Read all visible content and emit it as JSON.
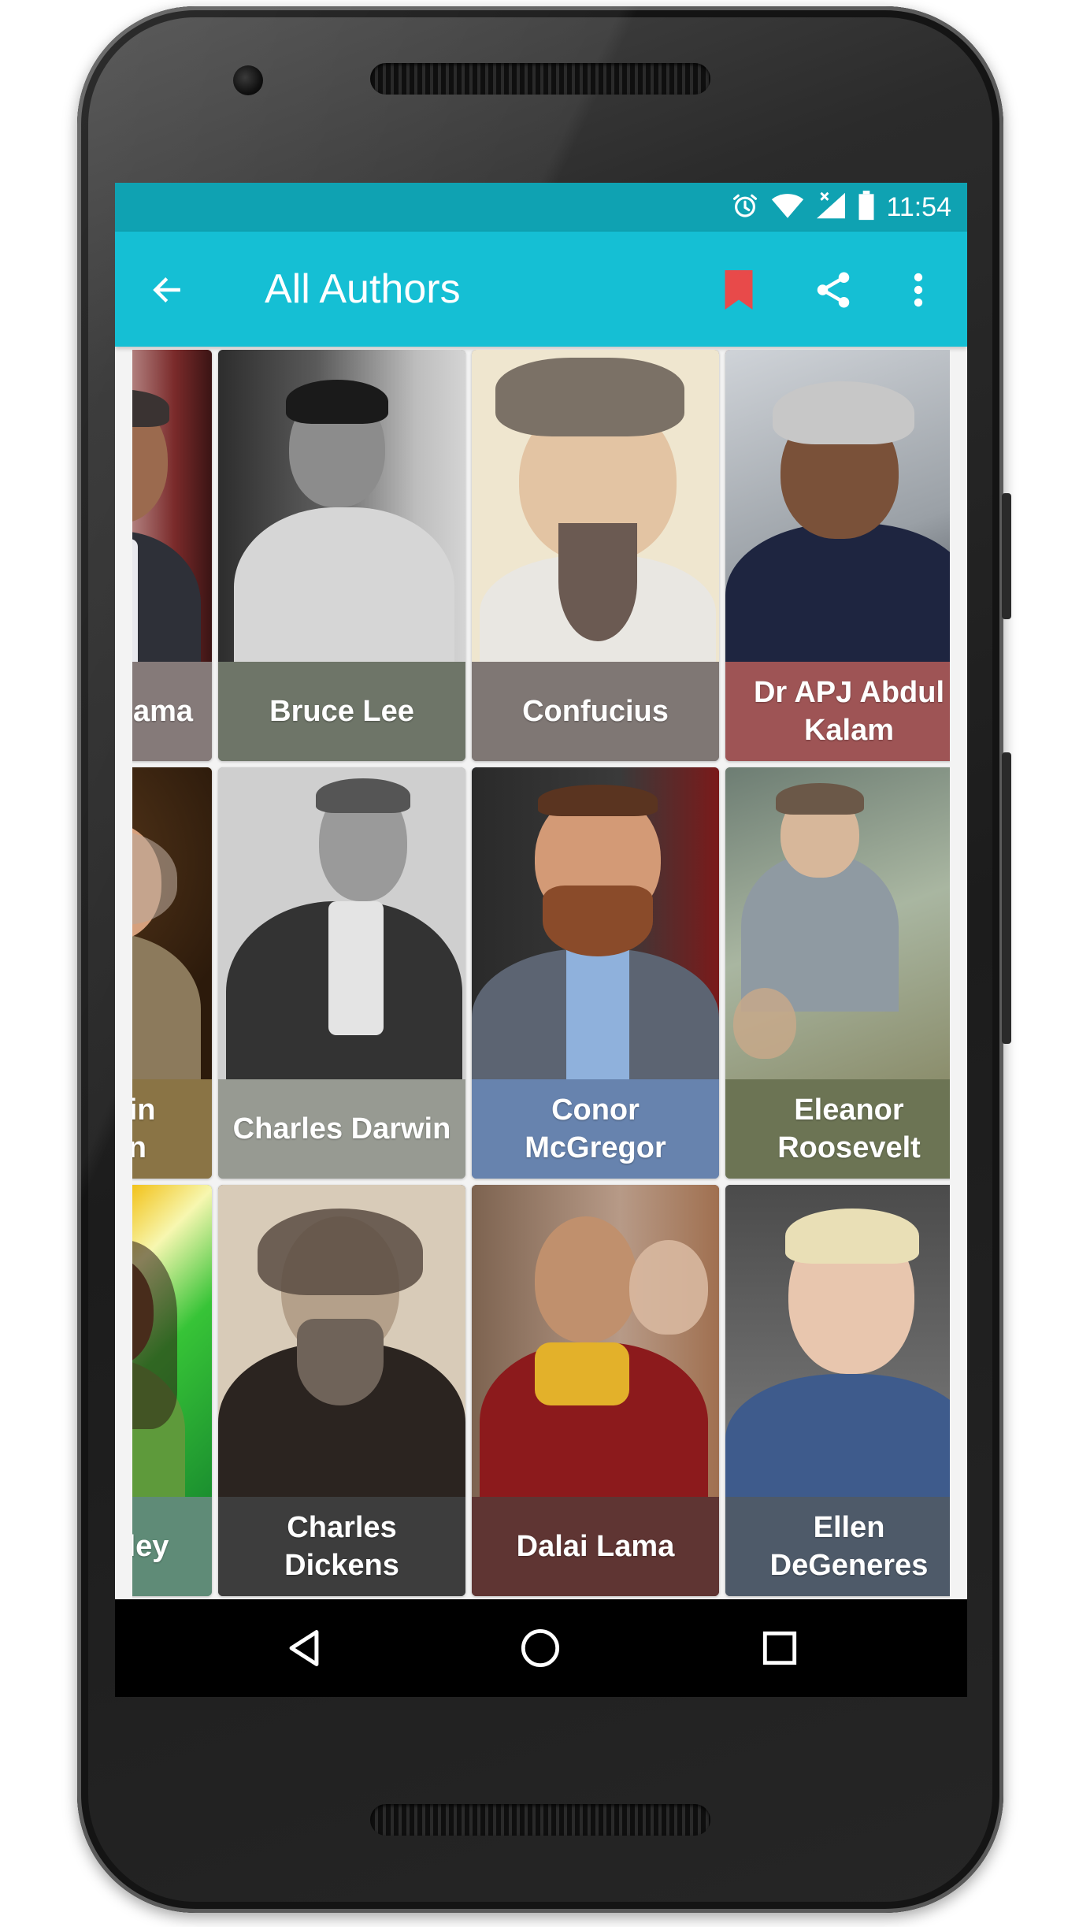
{
  "status_bar": {
    "time": "11:54",
    "icons": [
      "alarm-icon",
      "wifi-icon",
      "signal-icon",
      "battery-icon"
    ]
  },
  "app_bar": {
    "title": "All Authors",
    "actions": [
      "back-arrow-icon",
      "bookmark-icon",
      "share-icon",
      "more-vert-icon"
    ]
  },
  "colors": {
    "status_bar": "#0fa2b2",
    "app_bar": "#15bfd4",
    "bookmark": "#e84a4a"
  },
  "authors": [
    {
      "name": "Barack Obama",
      "caption_color": "#857a79"
    },
    {
      "name": "Bruce Lee",
      "caption_color": "#6e7568"
    },
    {
      "name": "Confucius",
      "caption_color": "#7f7774"
    },
    {
      "name": "Dr APJ Abdul Kalam",
      "caption_color": "#9e5455"
    },
    {
      "name": "Benjamin Franklin",
      "caption_color": "#8a7445"
    },
    {
      "name": "Charles Darwin",
      "caption_color": "#979a92"
    },
    {
      "name": "Conor McGregor",
      "caption_color": "#6783ae"
    },
    {
      "name": "Eleanor Roosevelt",
      "caption_color": "#6c7454"
    },
    {
      "name": "Bob Marley",
      "caption_color": "#5f8b77"
    },
    {
      "name": "Charles Dickens",
      "caption_color": "#3d3d3d"
    },
    {
      "name": "Dalai Lama",
      "caption_color": "#5f3533"
    },
    {
      "name": "Ellen DeGeneres",
      "caption_color": "#4e5a69"
    }
  ],
  "nav_bar": [
    "nav-back-icon",
    "nav-home-icon",
    "nav-recents-icon"
  ]
}
